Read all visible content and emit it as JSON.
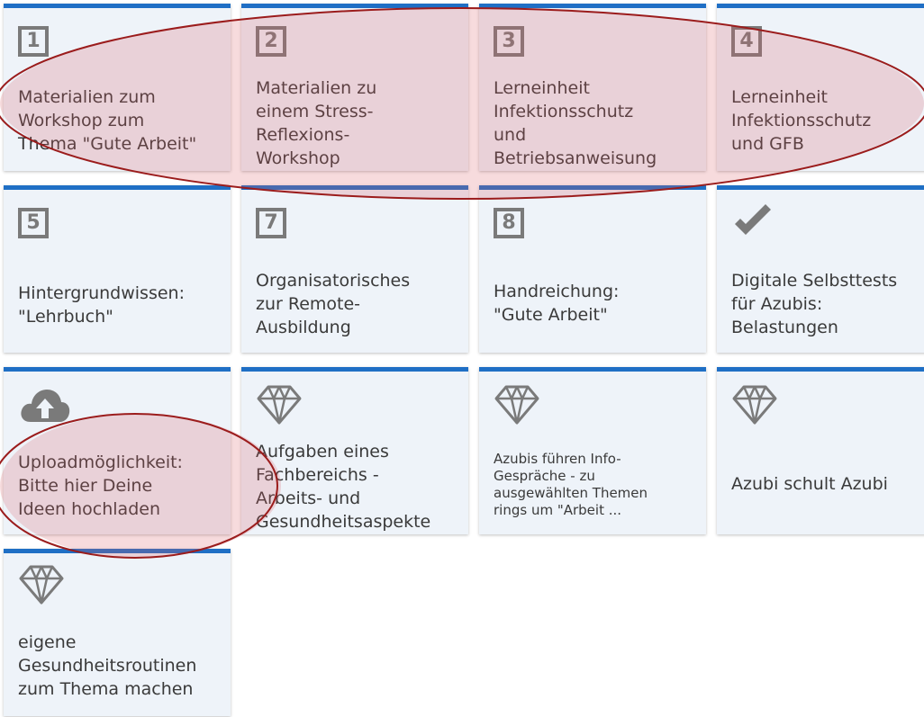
{
  "tiles": [
    {
      "icon_type": "number",
      "icon": "number-1-icon",
      "number": "1",
      "label": "Materialien zum\nWorkshop zum\nThema \"Gute Arbeit\""
    },
    {
      "icon_type": "number",
      "icon": "number-2-icon",
      "number": "2",
      "label": "Materialien zu\neinem Stress-\nReflexions-\nWorkshop"
    },
    {
      "icon_type": "number",
      "icon": "number-3-icon",
      "number": "3",
      "label": "Lerneinheit\nInfektionsschutz\nund\nBetriebsanweisung"
    },
    {
      "icon_type": "number",
      "icon": "number-4-icon",
      "number": "4",
      "label": "Lerneinheit\nInfektionsschutz\nund GFB"
    },
    {
      "icon_type": "number",
      "icon": "number-5-icon",
      "number": "5",
      "label": "Hintergrundwissen:\n\"Lehrbuch\""
    },
    {
      "icon_type": "number",
      "icon": "number-7-icon",
      "number": "7",
      "label": "Organisatorisches\nzur Remote-\nAusbildung"
    },
    {
      "icon_type": "number",
      "icon": "number-8-icon",
      "number": "8",
      "label": "Handreichung:\n\"Gute Arbeit\""
    },
    {
      "icon_type": "check",
      "icon": "checkmark-icon",
      "number": "",
      "label": "Digitale Selbsttests\nfür Azubis:\nBelastungen"
    },
    {
      "icon_type": "upload",
      "icon": "cloud-upload-icon",
      "number": "",
      "label": "Uploadmöglichkeit:\nBitte hier Deine\nIdeen hochladen"
    },
    {
      "icon_type": "diamond",
      "icon": "diamond-icon",
      "number": "",
      "label": "Aufgaben eines\nFachbereichs -\nArbeits- und\nGesundheitsaspekte"
    },
    {
      "icon_type": "diamond",
      "icon": "diamond-icon",
      "number": "",
      "label": "Azubis führen Info-\nGespräche - zu\nausgewählten Themen\nrings um \"Arbeit ..."
    },
    {
      "icon_type": "diamond",
      "icon": "diamond-icon",
      "number": "",
      "label": "Azubi schult Azubi"
    },
    {
      "icon_type": "diamond",
      "icon": "diamond-icon",
      "number": "",
      "label": "eigene\nGesundheitsroutinen\nzum Thema machen"
    }
  ],
  "colors": {
    "tile_bg": "#eef3f9",
    "tile_accent": "#1f6fc5",
    "icon_gray": "#7a7a7a",
    "text": "#3a3a3a",
    "annotation": "#9b1c1c"
  }
}
